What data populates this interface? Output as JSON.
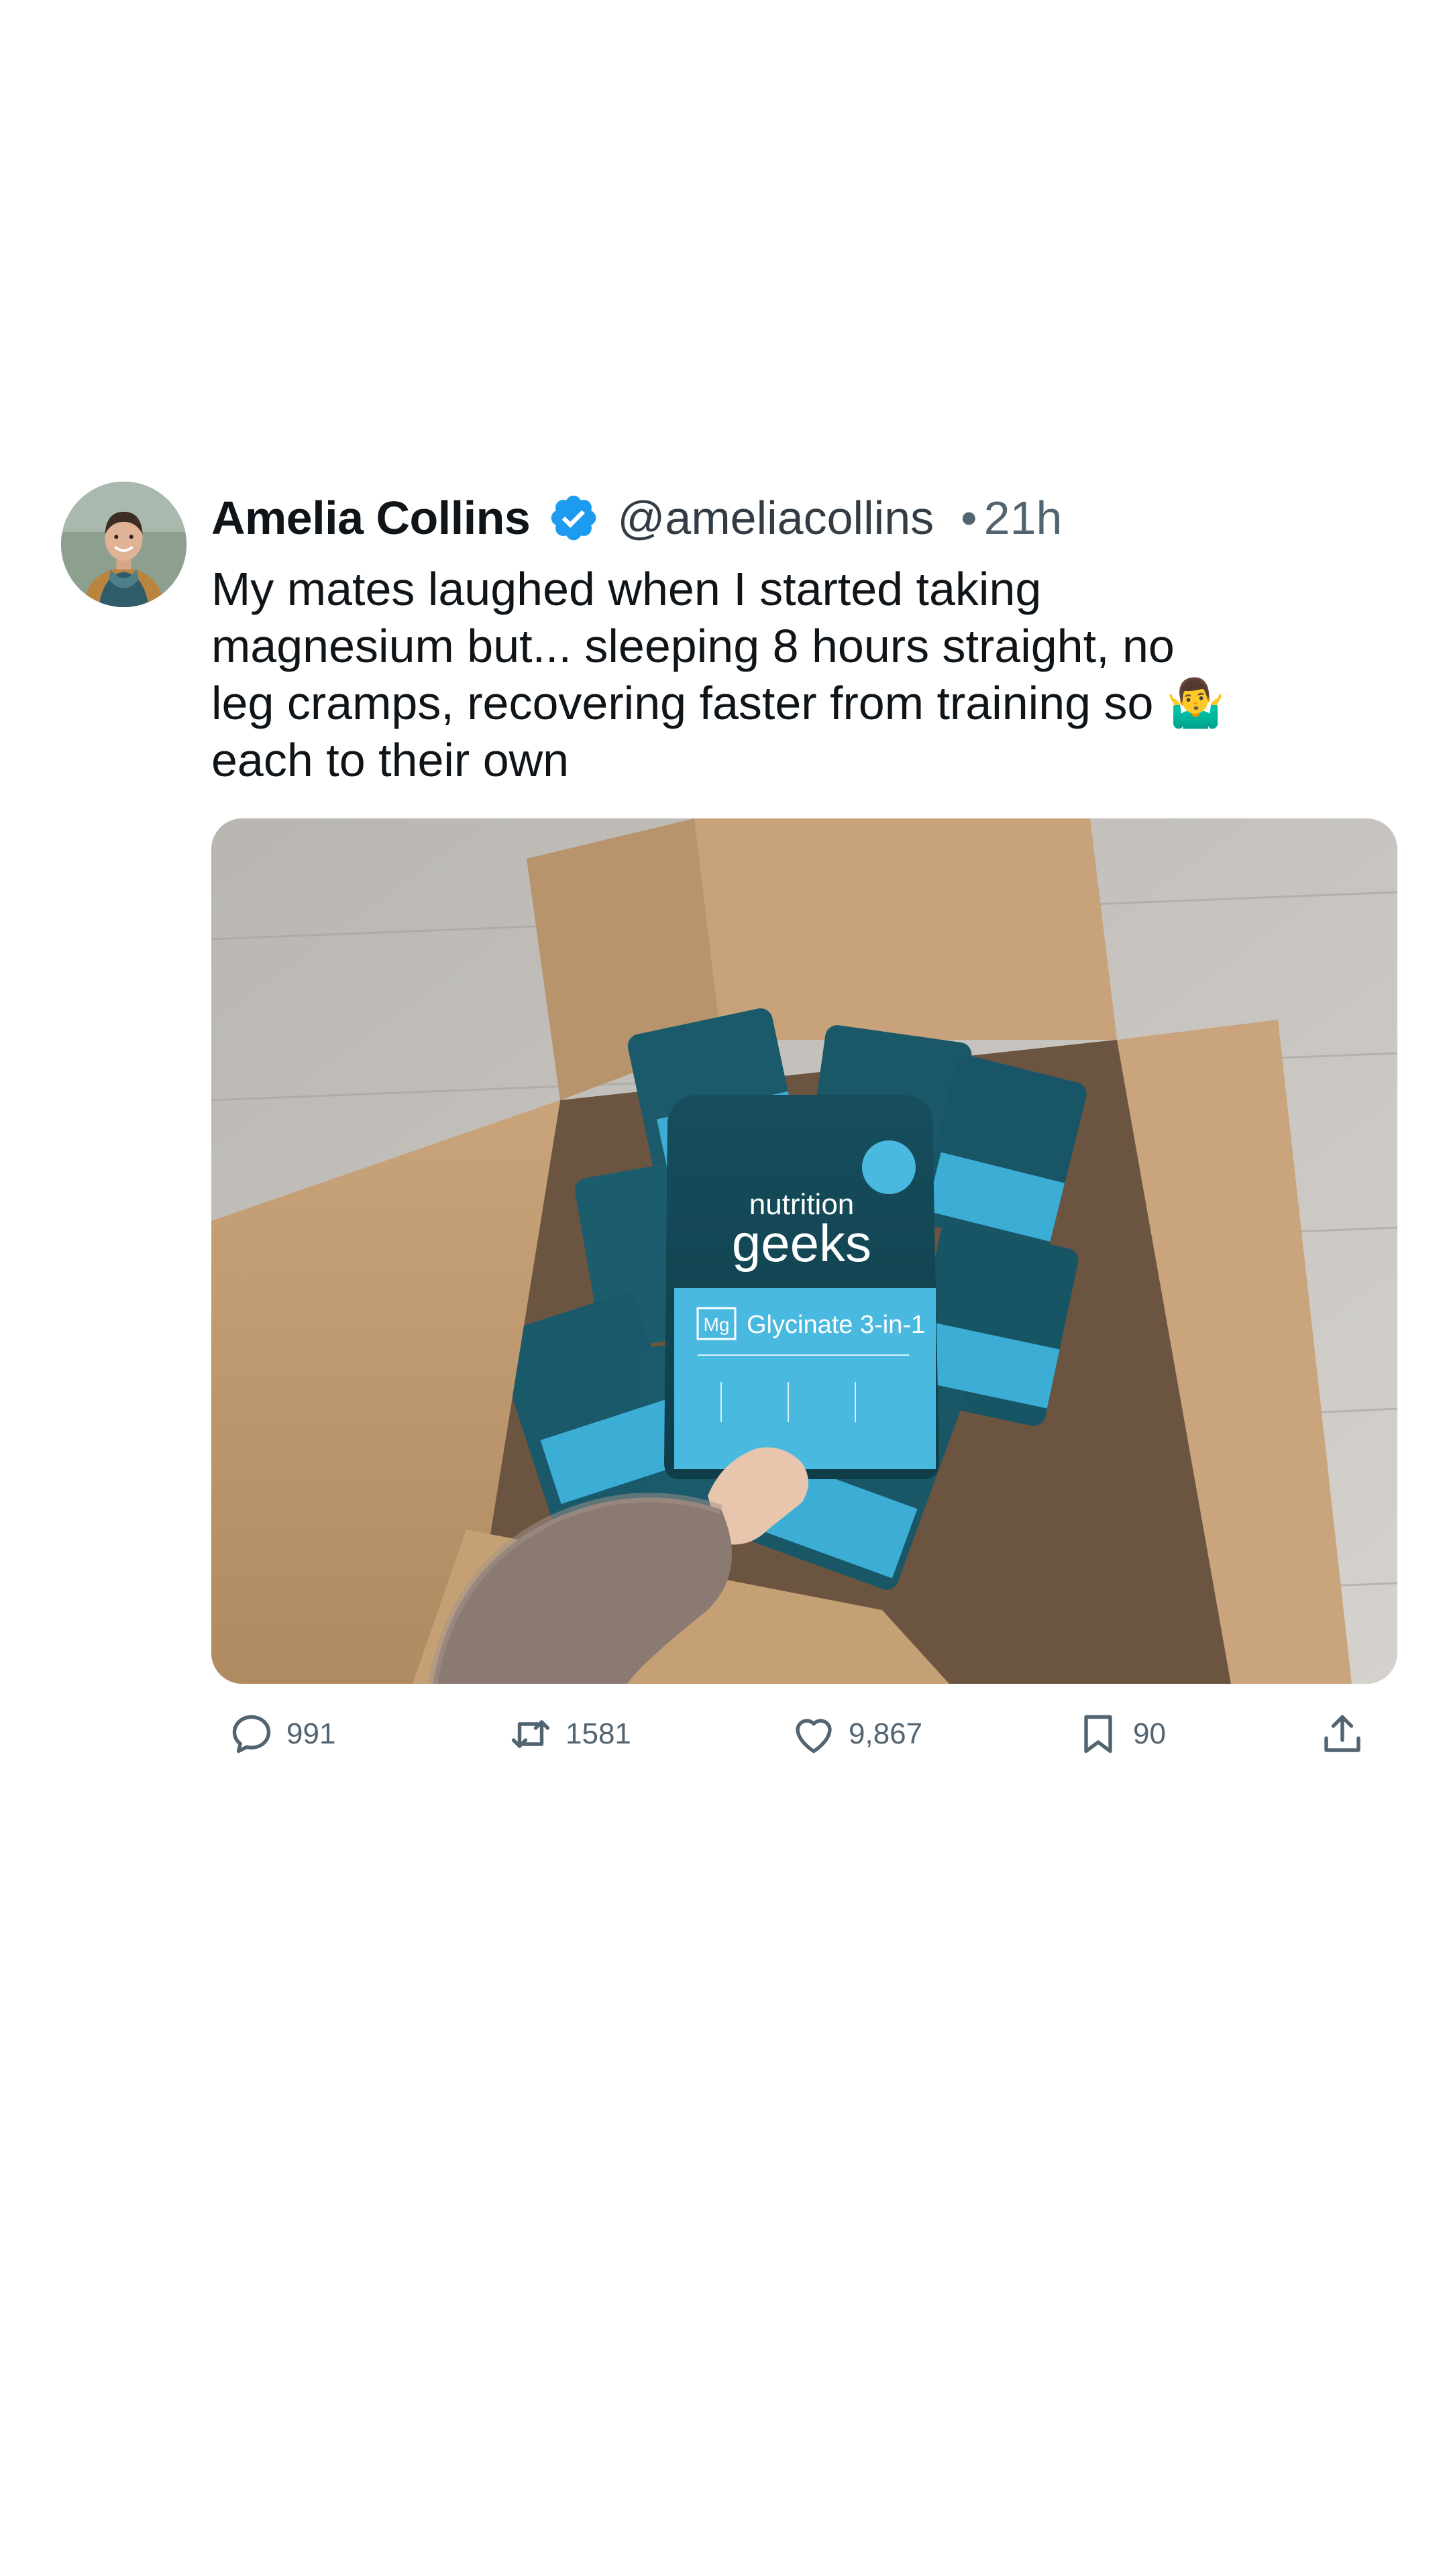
{
  "post": {
    "author": {
      "name": "Amelia Collins",
      "handle": "@ameliacollins",
      "verified": true,
      "avatar_icon": "profile-photo"
    },
    "separator": "•",
    "time": "21h",
    "text": "My mates laughed when I started taking\nmagnesium but... sleeping 8 hours straight, no\nleg cramps, recovering faster from training so 🤷‍♂️\neach to their own",
    "media": {
      "alt_icon": "photo",
      "product": {
        "brand_line1": "nutrition",
        "brand_line2": "geeks",
        "mg_badge": "Mg",
        "title": "Glycinate 3-in-1"
      }
    },
    "actions": {
      "reply": {
        "icon": "reply-icon",
        "count": "991"
      },
      "repost": {
        "icon": "repost-icon",
        "count": "1581"
      },
      "like": {
        "icon": "heart-icon",
        "count": "9,867"
      },
      "bookmark": {
        "icon": "bookmark-icon",
        "count": "90"
      },
      "share": {
        "icon": "share-icon"
      }
    }
  },
  "colors": {
    "verified": "#1d9bf0",
    "text": "#0f1419",
    "muted": "#536471",
    "icon": "#536471"
  }
}
